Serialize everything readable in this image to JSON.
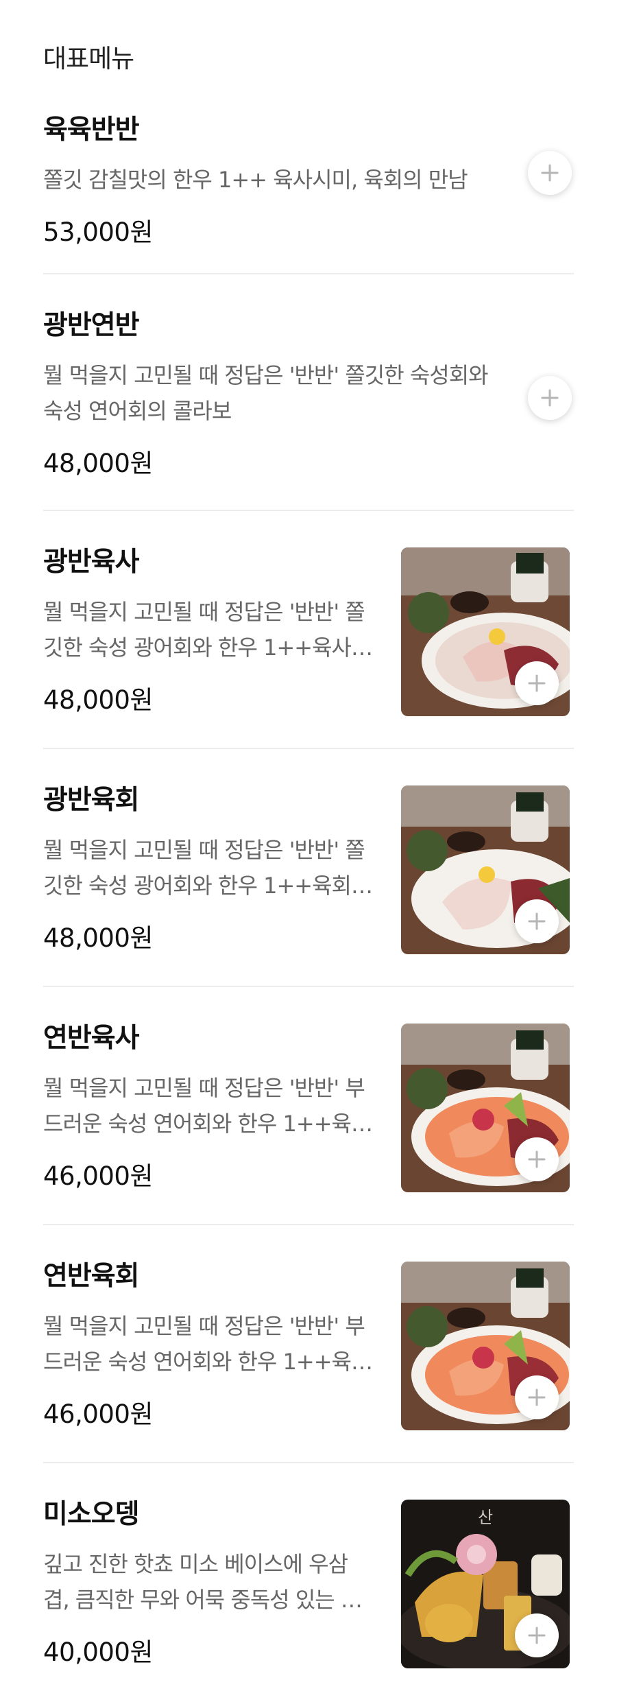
{
  "section": {
    "title": "대표메뉴"
  },
  "menu": [
    {
      "name": "육육반반",
      "desc": [
        "쫄깃 감칠맛의 한우 1++ 육사시미, 육회의 만남"
      ],
      "price": "53,000원",
      "has_image": false,
      "image": ""
    },
    {
      "name": "광반연반",
      "desc": [
        "뭘 먹을지 고민될 때 정답은 '반반' 쫄깃한 숙성회와",
        "숙성 연어회의 콜라보"
      ],
      "price": "48,000원",
      "has_image": false,
      "image": ""
    },
    {
      "name": "광반육사",
      "desc": [
        "뭘 먹을지 고민될 때 정답은 '반반' 쫄",
        "깃한 숙성 광어회와 한우 1++육사…"
      ],
      "price": "48,000원",
      "has_image": true,
      "image": "sashimi-platter"
    },
    {
      "name": "광반육회",
      "desc": [
        "뭘 먹을지 고민될 때 정답은 '반반' 쫄",
        "깃한 숙성 광어회와 한우 1++육회…"
      ],
      "price": "48,000원",
      "has_image": true,
      "image": "sashimi-platter"
    },
    {
      "name": "연반육사",
      "desc": [
        "뭘 먹을지 고민될 때 정답은 '반반' 부",
        "드러운 숙성 연어회와 한우 1++육…"
      ],
      "price": "46,000원",
      "has_image": true,
      "image": "salmon-platter"
    },
    {
      "name": "연반육회",
      "desc": [
        "뭘 먹을지 고민될 때 정답은 '반반' 부",
        "드러운 숙성 연어회와 한우 1++육…"
      ],
      "price": "46,000원",
      "has_image": true,
      "image": "salmon-platter"
    },
    {
      "name": "미소오뎅",
      "desc": [
        "깊고 진한 핫쵸 미소 베이스에 우삼",
        "겹, 큼직한 무와 어묵 중독성 있는 …"
      ],
      "price": "40,000원",
      "has_image": true,
      "image": "oden-pot",
      "image_text": "산"
    }
  ],
  "icons": {
    "add": "plus-icon"
  },
  "colors": {
    "divider": "#ececec",
    "desc": "#666666",
    "plus": "#b5b5b5"
  }
}
